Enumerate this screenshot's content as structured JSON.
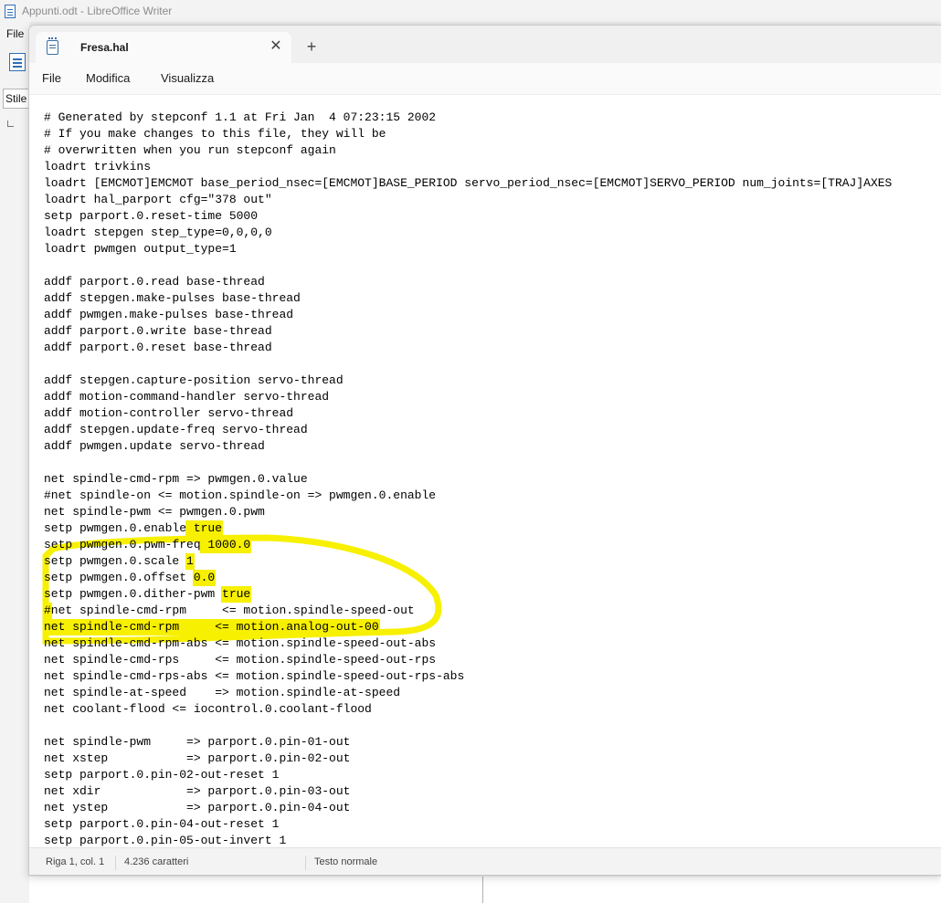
{
  "background_app": {
    "title": "Appunti.odt - LibreOffice Writer",
    "menu_file": "File",
    "style_box": "Stile"
  },
  "notepad": {
    "tab": {
      "title": "Fresa.hal",
      "close_glyph": "✕",
      "new_tab_glyph": "+"
    },
    "menu": [
      "File",
      "Modifica",
      "Visualizza"
    ],
    "code_lines": [
      "# Generated by stepconf 1.1 at Fri Jan  4 07:23:15 2002",
      "# If you make changes to this file, they will be",
      "# overwritten when you run stepconf again",
      "loadrt trivkins",
      "loadrt [EMCMOT]EMCMOT base_period_nsec=[EMCMOT]BASE_PERIOD servo_period_nsec=[EMCMOT]SERVO_PERIOD num_joints=[TRAJ]AXES",
      "loadrt hal_parport cfg=\"378 out\"",
      "setp parport.0.reset-time 5000",
      "loadrt stepgen step_type=0,0,0,0",
      "loadrt pwmgen output_type=1",
      "",
      "addf parport.0.read base-thread",
      "addf stepgen.make-pulses base-thread",
      "addf pwmgen.make-pulses base-thread",
      "addf parport.0.write base-thread",
      "addf parport.0.reset base-thread",
      "",
      "addf stepgen.capture-position servo-thread",
      "addf motion-command-handler servo-thread",
      "addf motion-controller servo-thread",
      "addf stepgen.update-freq servo-thread",
      "addf pwmgen.update servo-thread",
      "",
      "net spindle-cmd-rpm => pwmgen.0.value",
      "#net spindle-on <= motion.spindle-on => pwmgen.0.enable",
      "net spindle-pwm <= pwmgen.0.pwm",
      "setp pwmgen.0.enable true",
      "setp pwmgen.0.pwm-freq 1000.0",
      "setp pwmgen.0.scale 1",
      "setp pwmgen.0.offset 0.0",
      "setp pwmgen.0.dither-pwm true",
      "#net spindle-cmd-rpm     <= motion.spindle-speed-out",
      "net spindle-cmd-rpm     <= motion.analog-out-00",
      "net spindle-cmd-rpm-abs <= motion.spindle-speed-out-abs",
      "net spindle-cmd-rps     <= motion.spindle-speed-out-rps",
      "net spindle-cmd-rps-abs <= motion.spindle-speed-out-rps-abs",
      "net spindle-at-speed    => motion.spindle-at-speed",
      "net coolant-flood <= iocontrol.0.coolant-flood",
      "",
      "net spindle-pwm     => parport.0.pin-01-out",
      "net xstep           => parport.0.pin-02-out",
      "setp parport.0.pin-02-out-reset 1",
      "net xdir            => parport.0.pin-03-out",
      "net ystep           => parport.0.pin-04-out",
      "setp parport.0.pin-04-out-reset 1",
      "setp parport.0.pin-05-out-invert 1"
    ],
    "status": {
      "position": "Riga 1, col. 1",
      "chars": "4.236 caratteri",
      "style": "Testo normale"
    },
    "highlight_color": "#f7f000"
  }
}
